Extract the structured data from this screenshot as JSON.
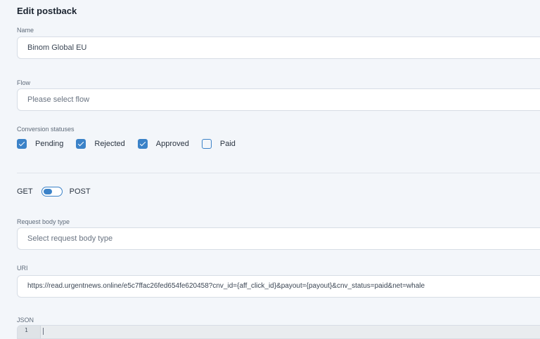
{
  "page": {
    "title": "Edit postback"
  },
  "name": {
    "label": "Name",
    "value": "Binom Global EU"
  },
  "flow": {
    "label": "Flow",
    "placeholder": "Please select flow"
  },
  "conversion_statuses": {
    "label": "Conversion statuses",
    "items": [
      {
        "label": "Pending",
        "checked": true
      },
      {
        "label": "Rejected",
        "checked": true
      },
      {
        "label": "Approved",
        "checked": true
      },
      {
        "label": "Paid",
        "checked": false
      }
    ]
  },
  "method": {
    "left_label": "GET",
    "right_label": "POST",
    "selected": "GET"
  },
  "request_body_type": {
    "label": "Request body type",
    "placeholder": "Select request body type"
  },
  "uri": {
    "label": "URI",
    "value": "https://read.urgentnews.online/e5c7ffac26fed654fe620458?cnv_id={aff_click_id}&payout={payout}&cnv_status=paid&net=whale"
  },
  "json": {
    "label": "JSON",
    "line_number": "1"
  },
  "colors": {
    "accent": "#3b82c8",
    "background": "#f3f6fa",
    "field_border": "#d7dde5"
  }
}
